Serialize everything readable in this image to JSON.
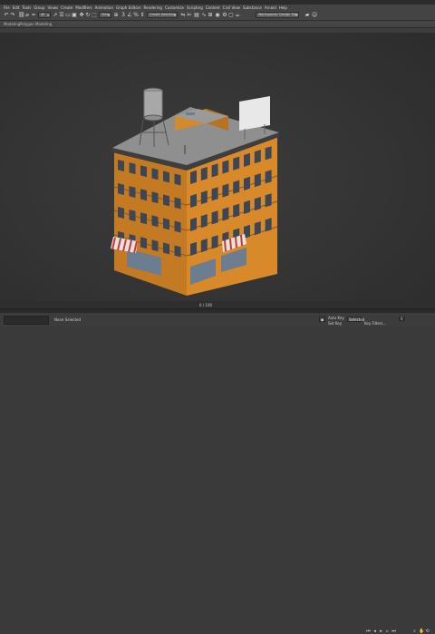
{
  "menubar": {
    "items": [
      "File",
      "Edit",
      "Tools",
      "Group",
      "Views",
      "Create",
      "Modifiers",
      "Animation",
      "Graph Editors",
      "Rendering",
      "Customize",
      "Scripting",
      "Content",
      "Civil View",
      "Substance",
      "Arnold",
      "Help"
    ]
  },
  "toolbar": {
    "selection_set": "Create Selection Set",
    "workspace": "Workspaces: Design Standard",
    "icons": [
      "undo-icon",
      "redo-icon",
      "link-icon",
      "unlink-icon",
      "bind-icon",
      "selection-filter-icon",
      "select-icon",
      "select-by-name-icon",
      "rect-region-icon",
      "window-crossing-icon",
      "move-icon",
      "rotate-icon",
      "scale-icon",
      "reference-coord-icon",
      "pivot-icon",
      "snap-icon",
      "angle-snap-icon",
      "percent-snap-icon",
      "spinner-snap-icon",
      "mirror-icon",
      "align-icon",
      "layer-icon",
      "curve-editor-icon",
      "schematic-icon",
      "material-editor-icon",
      "render-setup-icon",
      "render-frame-icon",
      "render-icon"
    ]
  },
  "ribbon": {
    "label": "Modeling",
    "sublabel": "Polygon Modeling"
  },
  "status": {
    "selected": "None Selected",
    "frame": "0 / 100",
    "auto_key": "Auto Key",
    "set_key": "Set Key",
    "key_filters": "Key Filters...",
    "selected_dropdown": "Selected",
    "time": "0"
  },
  "colors": {
    "facade": "#e0922e",
    "facade_side": "#c97c21",
    "roof": "#8e8e8e",
    "awning_red": "#c33a3a",
    "glass": "#6c7d90"
  }
}
